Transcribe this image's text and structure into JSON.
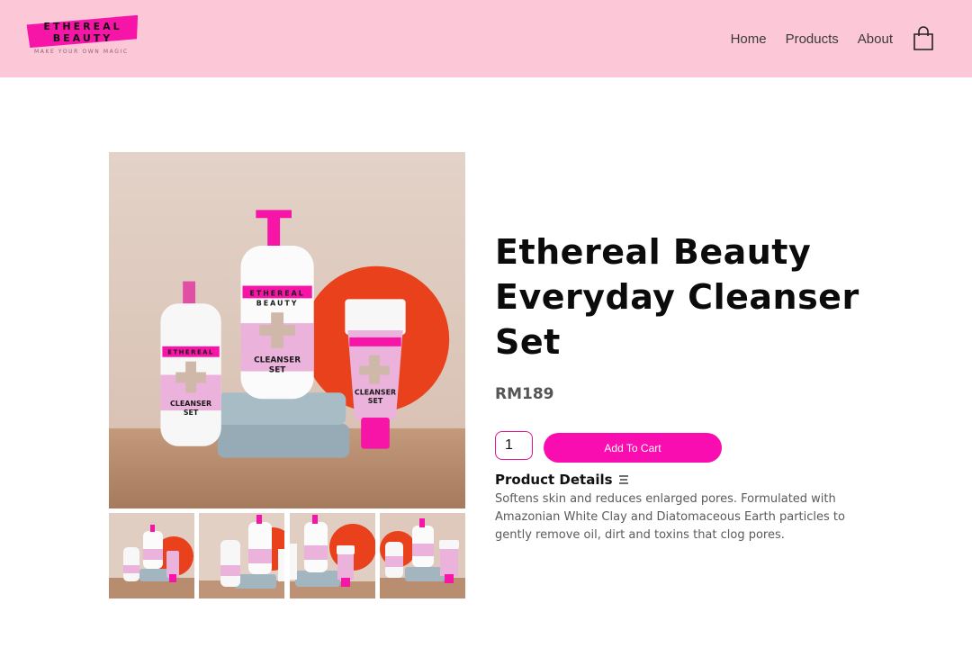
{
  "brand": {
    "line1": "ETHEREAL",
    "line2": "BEAUTY",
    "tagline": "MAKE YOUR OWN MAGIC"
  },
  "colors": {
    "header_bg": "#fcc7d6",
    "accent": "#f90db0"
  },
  "nav": {
    "items": [
      {
        "label": "Home"
      },
      {
        "label": "Products"
      },
      {
        "label": "About"
      }
    ],
    "cart_icon": "shopping-bag-icon"
  },
  "product": {
    "title": "Ethereal Beauty Everyday Cleanser Set",
    "price": "RM189",
    "quantity": "1",
    "add_to_cart_label": "Add To Cart",
    "details_title": "Product Details",
    "details_icon": "menu-lines-icon",
    "description": "Softens skin and reduces enlarged pores. Formulated with Amazonian White Clay and Diatomaceous Earth particles to gently remove oil, dirt and toxins that clog pores.",
    "product_label": {
      "brand1": "ETHEREAL",
      "brand2": "BEAUTY",
      "name1": "CLEANSER",
      "name2": "SET"
    },
    "thumbnail_count": 4
  }
}
